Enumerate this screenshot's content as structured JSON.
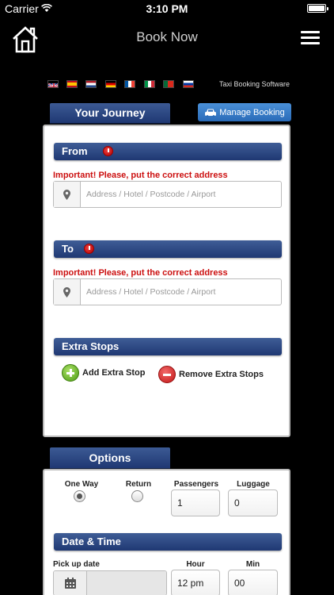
{
  "status": {
    "carrier": "Carrier",
    "time": "3:10 PM"
  },
  "nav": {
    "title": "Book Now"
  },
  "languages": [
    {
      "name": "English",
      "icon": "uk-flag-icon"
    },
    {
      "name": "Spanish",
      "icon": "spain-flag-icon"
    },
    {
      "name": "Dutch",
      "icon": "netherlands-flag-icon"
    },
    {
      "name": "German",
      "icon": "germany-flag-icon"
    },
    {
      "name": "French",
      "icon": "france-flag-icon"
    },
    {
      "name": "Italian",
      "icon": "italy-flag-icon"
    },
    {
      "name": "Portuguese",
      "icon": "portugal-flag-icon"
    },
    {
      "name": "Russian",
      "icon": "russia-flag-icon"
    }
  ],
  "tagline": "Taxi Booking Software",
  "journey": {
    "tab_label": "Your Journey",
    "manage_label": "Manage Booking",
    "from": {
      "label": "From",
      "warning": "Important! Please, put the correct address",
      "placeholder": "Address / Hotel / Postcode / Airport"
    },
    "to": {
      "label": "To",
      "warning": "Important! Please, put the correct address",
      "placeholder": "Address / Hotel / Postcode / Airport"
    },
    "extra_stops": {
      "label": "Extra Stops",
      "add_label": "Add Extra Stop",
      "remove_label": "Remove Extra Stops"
    }
  },
  "options": {
    "tab_label": "Options",
    "one_way_label": "One Way",
    "return_label": "Return",
    "selected": "One Way",
    "passengers_label": "Passengers",
    "passengers_value": "1",
    "luggage_label": "Luggage",
    "luggage_value": "0",
    "datetime": {
      "label": "Date & Time",
      "pickup_label": "Pick up date",
      "hour_label": "Hour",
      "hour_value": "12 pm",
      "min_label": "Min",
      "min_value": "00"
    }
  },
  "colors": {
    "header_blue": "#1f3873",
    "manage_blue": "#2a6bb8",
    "warning_red": "#cc1010",
    "add_green": "#4d9c13",
    "remove_red": "#c21515"
  }
}
